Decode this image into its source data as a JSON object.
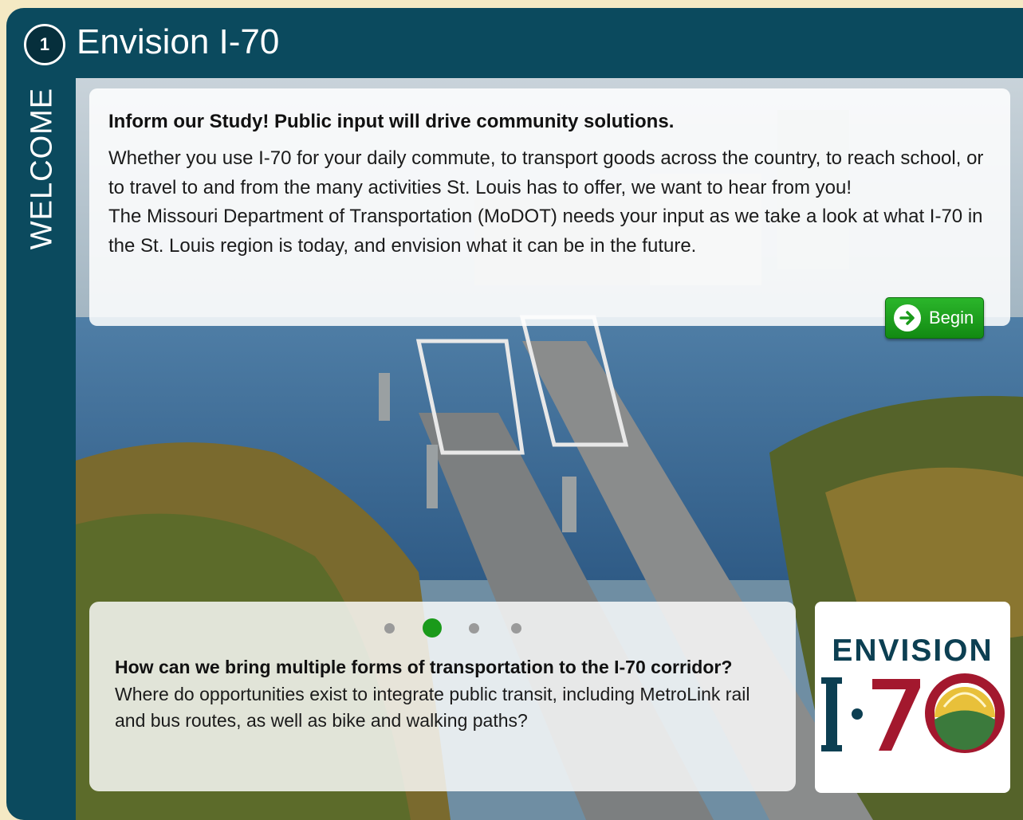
{
  "header": {
    "step_number": "1",
    "title": "Envision I-70"
  },
  "sidebar": {
    "tab_label": "WELCOME"
  },
  "intro": {
    "heading": "Inform our Study! Public input will drive community solutions.",
    "paragraph1": "Whether you use I-70 for your daily commute, to transport goods across the country, to reach school, or to travel to and from the many activities St. Louis has to offer, we want to hear from you!",
    "paragraph2": "The Missouri Department of Transportation (MoDOT) needs your input as we take a look at what I-70 in the St. Louis region is today, and envision what it can be in the future.",
    "begin_label": "Begin"
  },
  "carousel": {
    "active_index": 1,
    "count": 4,
    "question_bold": "How can we bring multiple forms of transportation to the I-70 corridor?",
    "question_rest": " Where do opportunities exist to integrate public transit, including MetroLink rail and bus routes, as well as bike and walking paths?"
  },
  "logo": {
    "word": "ENVISION",
    "mark": "I·70"
  },
  "colors": {
    "header_bg": "#0b4a5e",
    "begin_green": "#1a9a1a",
    "logo_navy": "#0c3f52",
    "logo_red": "#a3182e",
    "logo_green": "#3b7a3c",
    "logo_yellow": "#e8c03a"
  }
}
